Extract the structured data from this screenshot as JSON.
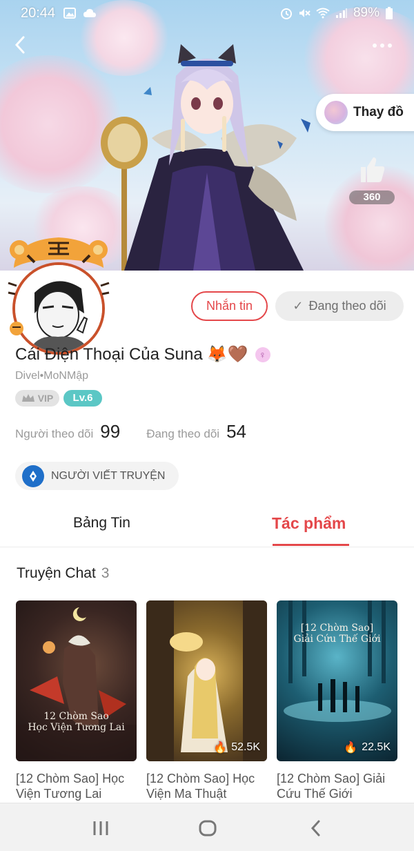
{
  "status_bar": {
    "time": "20:44",
    "battery": "89%"
  },
  "hero": {
    "outfit_label": "Thay đồ",
    "like_count": "360"
  },
  "profile": {
    "message_label": "Nhắn tin",
    "following_label": "Đang theo dõi",
    "name": "Cái Điện Thoại Của Suna",
    "name_emojis": "🦊🤎",
    "sub_name": "Divel•MoNMập",
    "vip_label": "VIP",
    "level_label": "Lv.6",
    "followers_label": "Người theo dõi",
    "followers_count": "99",
    "following_stat_label": "Đang theo dõi",
    "following_count": "54",
    "role_label": "NGƯỜI VIẾT TRUYỆN"
  },
  "tabs": [
    {
      "label": "Bảng Tin",
      "active": false
    },
    {
      "label": "Tác phẩm",
      "active": true
    }
  ],
  "section": {
    "title": "Truyện Chat",
    "count": "3"
  },
  "stories": [
    {
      "title": "[12 Chòm Sao] Học Viện Tương Lai",
      "views": "",
      "cover_text": "12 Chòm Sao\nHọc Viện Tương Lai"
    },
    {
      "title": "[12 Chòm Sao] Học Viện Ma Thuật",
      "views": "52.5K",
      "cover_text": ""
    },
    {
      "title": "[12 Chòm Sao] Giải Cứu Thế Giới",
      "views": "22.5K",
      "cover_text": "[12 Chòm Sao]\nGiải Cứu Thế Giới"
    }
  ],
  "colors": {
    "accent": "#e4474a",
    "level_badge": "#5bc7c5",
    "role_icon": "#1f6fc9"
  }
}
